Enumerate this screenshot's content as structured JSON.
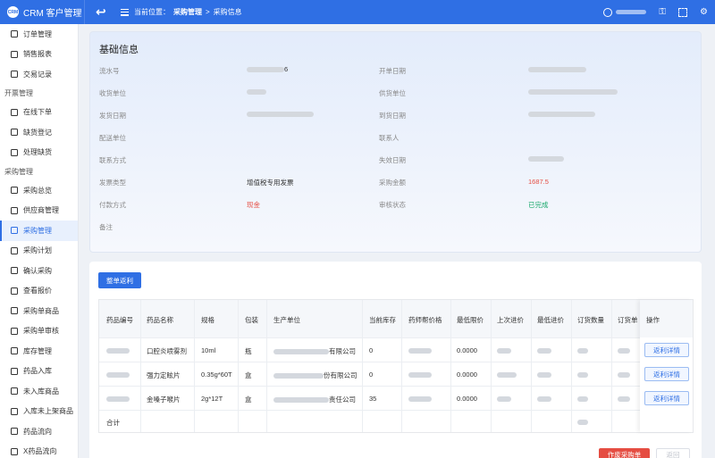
{
  "app": {
    "logo_text": "CRM",
    "title": "CRM 客户管理"
  },
  "breadcrumb": {
    "prefix": "当前位置：",
    "section": "采购管理",
    "separator": ">",
    "current": "采购信息"
  },
  "sidebar": {
    "items": [
      {
        "label": "订单管理",
        "icon": "order-icon"
      },
      {
        "label": "销售报表",
        "icon": "report-icon"
      },
      {
        "label": "交易记录",
        "icon": "record-icon"
      }
    ],
    "group1": "开票管理",
    "items1": [
      {
        "label": "在线下单",
        "icon": "document-icon"
      },
      {
        "label": "缺货登记",
        "icon": "document-icon"
      },
      {
        "label": "处理缺货",
        "icon": "layers-icon"
      }
    ],
    "group2": "采购管理",
    "items2": [
      {
        "label": "采购总览",
        "icon": "document-icon"
      },
      {
        "label": "供应商管理",
        "icon": "supplier-icon"
      },
      {
        "label": "采购管理",
        "icon": "chart-icon"
      },
      {
        "label": "采购计划",
        "icon": "cart-icon"
      },
      {
        "label": "确认采购",
        "icon": "layers-icon"
      },
      {
        "label": "查看报价",
        "icon": "table-icon"
      },
      {
        "label": "采购单商品",
        "icon": "table-icon"
      },
      {
        "label": "采购单审核",
        "icon": "table-icon"
      },
      {
        "label": "库存管理",
        "icon": "box-icon"
      },
      {
        "label": "药品入库",
        "icon": "list-icon"
      },
      {
        "label": "未入库商品",
        "icon": "document-icon"
      },
      {
        "label": "入库未上架商品",
        "icon": "document-icon"
      },
      {
        "label": "药品流向",
        "icon": "flow-icon"
      },
      {
        "label": "X药品流向",
        "icon": "flow-icon"
      }
    ]
  },
  "info": {
    "title": "基础信息",
    "labels": {
      "serial": "流水号",
      "receiver": "收货单位",
      "ship_date": "发货日期",
      "delivery": "配送单位",
      "contact_method": "联系方式",
      "invoice_type": "发票类型",
      "pay_method": "付款方式",
      "remark": "备注",
      "order_date": "开单日期",
      "supplier": "供货单位",
      "arrive_date": "到货日期",
      "contact": "联系人",
      "expire_date": "失效日期",
      "amount": "采购金额",
      "audit": "审核状态"
    },
    "values": {
      "serial_suffix": "6",
      "invoice_type": "增值税专用发票",
      "pay_method": "现金",
      "amount": "1687.5",
      "audit": "已完成"
    }
  },
  "table": {
    "action_button": "整单返利",
    "headers": [
      "药品编号",
      "药品名称",
      "规格",
      "包装",
      "生产单位",
      "当前库存",
      "药师帮价格",
      "最低限价",
      "上次进价",
      "最低进价",
      "订货数量",
      "订货单",
      "操作"
    ],
    "rows": [
      {
        "name": "口腔炎喷雾剂",
        "spec": "10ml",
        "pack": "瓶",
        "maker_suffix": "有限公司",
        "stock": "0",
        "min_limit": "0.0000",
        "op": "返利详情"
      },
      {
        "name": "强力定眩片",
        "spec": "0.35g*60T",
        "pack": "盒",
        "maker_suffix": "份有限公司",
        "stock": "0",
        "min_limit": "0.0000",
        "op": "返利详情"
      },
      {
        "name": "金嗓子喉片",
        "spec": "2g*12T",
        "pack": "盒",
        "maker_suffix": "责任公司",
        "stock": "35",
        "min_limit": "0.0000",
        "op": "返利详情"
      }
    ],
    "total_label": "合计"
  },
  "footer": {
    "void_button": "作废采购单",
    "return_button": "返回"
  },
  "colors": {
    "primary": "#2f6fe4",
    "danger": "#e54d42",
    "success": "#1aa96b"
  }
}
